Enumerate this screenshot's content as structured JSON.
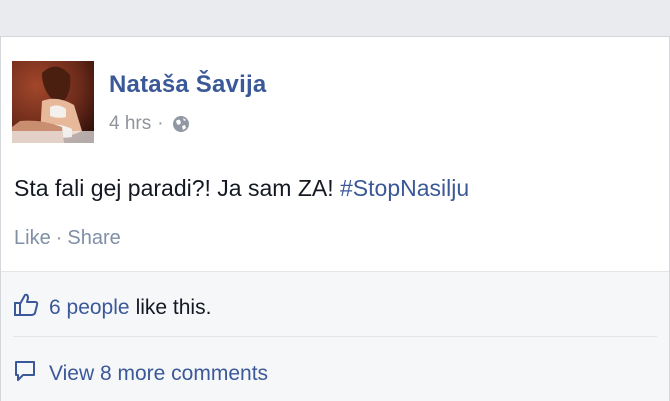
{
  "post": {
    "author": "Nataša Šavija",
    "time": "4 hrs",
    "dot": "·",
    "text": "Sta fali gej paradi?! Ja sam ZA!",
    "hashtag": "#StopNasilju",
    "actions": {
      "like": "Like",
      "separator": "·",
      "share": "Share"
    }
  },
  "ufi": {
    "likes_people": "6 people",
    "likes_tail": "like this.",
    "view_comments": "View 8 more comments"
  },
  "icons": {
    "privacy": "globe-icon",
    "like": "thumbs-up-icon",
    "comment": "comment-bubble-icon"
  },
  "colors": {
    "link": "#3b5998",
    "text": "#141823",
    "meta": "#90949c",
    "ufi_background": "#f6f7f9"
  }
}
